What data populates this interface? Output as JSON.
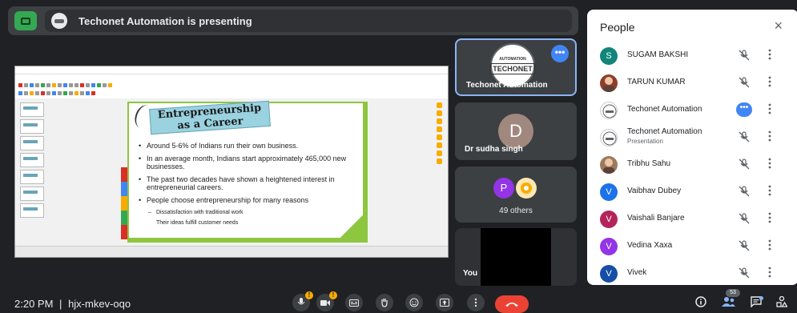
{
  "topbar": {
    "presenting_text": "Techonet Automation is presenting"
  },
  "slide": {
    "title_line1": "Entrepreneurship",
    "title_line2": "as a Career",
    "bullets": [
      "Around 5-6% of Indians run their own business.",
      "In an average month, Indians start approximately 465,000 new businesses.",
      "The past two decades have shown a heightened interest in entrepreneurial careers.",
      "People choose entrepreneurship for many reasons"
    ],
    "sub_bullets": [
      "Dissatisfaction with traditional work",
      "Their ideas fulfill customer needs"
    ]
  },
  "tiles": {
    "presenter_name": "Techonet Automation",
    "presenter_logo_top": "AUTOMATION",
    "presenter_logo_main": "TECHONET",
    "second_name": "Dr sudha singh",
    "second_initial": "D",
    "others_initial": "P",
    "others_label": "49 others",
    "you_label": "You"
  },
  "people": {
    "header": "People",
    "close": "×",
    "list": [
      {
        "name": "SUGAM BAKSHI",
        "initial": "S",
        "color": "#12857a",
        "sub": "",
        "state": "muted"
      },
      {
        "name": "TARUN KUMAR",
        "initial": "",
        "color": "#8d3f2a",
        "sub": "",
        "state": "muted"
      },
      {
        "name": "Techonet Automation",
        "initial": "",
        "color": "#ffffff",
        "sub": "",
        "state": "speaking"
      },
      {
        "name": "Techonet Automation",
        "initial": "",
        "color": "#ffffff",
        "sub": "Presentation",
        "state": "muted"
      },
      {
        "name": "Tribhu Sahu",
        "initial": "",
        "color": "#9c7b5c",
        "sub": "",
        "state": "muted"
      },
      {
        "name": "Vaibhav Dubey",
        "initial": "V",
        "color": "#1a73e8",
        "sub": "",
        "state": "muted"
      },
      {
        "name": "Vaishali Banjare",
        "initial": "V",
        "color": "#b3245b",
        "sub": "",
        "state": "muted"
      },
      {
        "name": "Vedina Xaxa",
        "initial": "V",
        "color": "#9334e6",
        "sub": "",
        "state": "muted"
      },
      {
        "name": "Vivek",
        "initial": "V",
        "color": "#174ea6",
        "sub": "",
        "state": "muted"
      }
    ]
  },
  "bottom": {
    "time": "2:20 PM",
    "separator": "|",
    "meeting_code": "hjx-mkev-oqo",
    "participant_count": "53"
  }
}
